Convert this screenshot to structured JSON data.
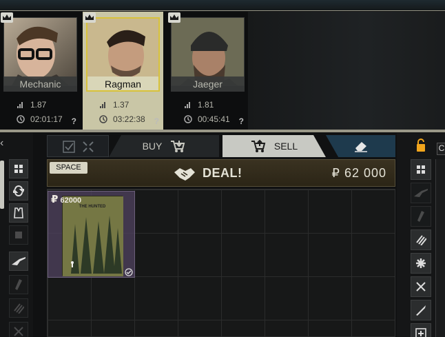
{
  "traders": [
    {
      "name": "Mechanic",
      "level": "1.87",
      "timer": "02:01:17",
      "active": false
    },
    {
      "name": "Ragman",
      "level": "1.37",
      "timer": "03:22:38",
      "active": true
    },
    {
      "name": "Jaeger",
      "level": "1.81",
      "timer": "00:45:41",
      "active": false
    }
  ],
  "unknown_mark": "?",
  "tabs": {
    "buy_label": "BUY",
    "sell_label": "SELL"
  },
  "deal": {
    "space_label": "SPACE",
    "deal_label": "DEAL!",
    "total_price": "₽ 62 000"
  },
  "item": {
    "price": "62000",
    "currency_symbol": "₽",
    "poster_title": "THE HUNTED"
  },
  "right_letter": "C",
  "colors": {
    "accent_gold": "#d8c23a",
    "sell_tab": "#c8c9c3",
    "deal_bar": "#3a3221"
  }
}
